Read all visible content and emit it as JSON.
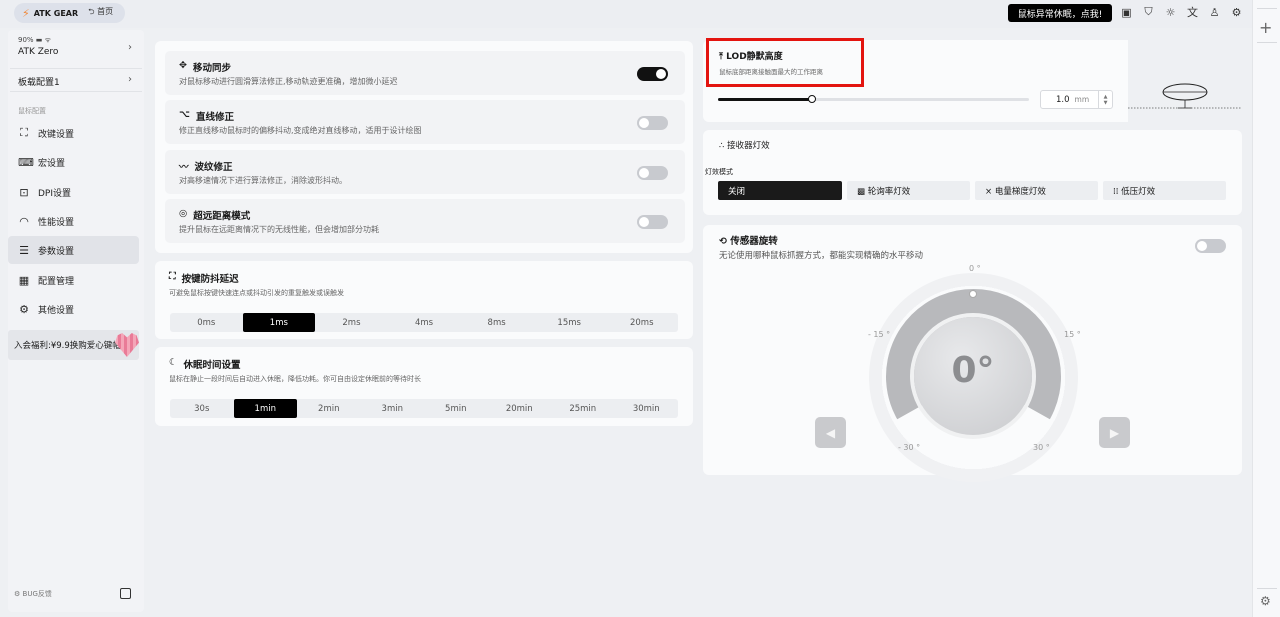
{
  "topbar": {
    "brand": "ATK GEAR",
    "home": "首页",
    "alert_button": "鼠标异常休眠，点我!"
  },
  "sidebar": {
    "device_battery": "90%",
    "device_name": "ATK Zero",
    "profile": "板载配置1",
    "section_title": "鼠标配置",
    "items": [
      {
        "label": "改键设置",
        "icon": "mouse-icon"
      },
      {
        "label": "宏设置",
        "icon": "terminal-icon"
      },
      {
        "label": "DPI设置",
        "icon": "dpi-icon"
      },
      {
        "label": "性能设置",
        "icon": "gauge-icon"
      },
      {
        "label": "参数设置",
        "icon": "sliders-icon"
      },
      {
        "label": "配置管理",
        "icon": "grid-icon"
      },
      {
        "label": "其他设置",
        "icon": "settings-icon"
      }
    ],
    "active_index": 4,
    "promo": "入会福利:¥9.9换购爱心键帽",
    "bug_label": "BUG反馈"
  },
  "settings": [
    {
      "title": "移动同步",
      "desc": "对鼠标移动进行圆滑算法修正,移动轨迹更准确，增加微小延迟",
      "on": true
    },
    {
      "title": "直线修正",
      "desc": "修正直线移动鼠标时的偏移抖动,变成绝对直线移动，适用于设计绘图",
      "on": false
    },
    {
      "title": "波纹修正",
      "desc": "对高移速情况下进行算法修正，消除波形抖动。",
      "on": false
    },
    {
      "title": "超远距离模式",
      "desc": "提升鼠标在远距离情况下的无线性能，但会增加部分功耗",
      "on": false
    }
  ],
  "debounce": {
    "title": "按键防抖延迟",
    "desc": "可避免鼠标按键快速连点或抖动引发的重复触发或误触发",
    "options": [
      "0ms",
      "1ms",
      "2ms",
      "4ms",
      "8ms",
      "15ms",
      "20ms"
    ],
    "selected": 1
  },
  "sleep": {
    "title": "休眠时间设置",
    "desc": "鼠标在静止一段时间后自动进入休眠，降低功耗。你可自由设定休眠前的等待时长",
    "options": [
      "30s",
      "1min",
      "2min",
      "3min",
      "5min",
      "20min",
      "25min",
      "30min"
    ],
    "selected": 1
  },
  "lod": {
    "title": "LOD静默高度",
    "desc": "鼠标底部距离接触面最大的工作距离",
    "value": "1.0",
    "unit": "mm",
    "level_fraction": 0.3
  },
  "receiver": {
    "title": "接收器灯效",
    "mode_label": "灯效模式",
    "options": [
      "关闭",
      "轮询率灯效",
      "电量梯度灯效",
      "低压灯效"
    ],
    "selected": 0
  },
  "sensor": {
    "title": "传感器旋转",
    "desc": "无论使用哪种鼠标抓握方式，都能实现精确的水平移动",
    "on": false,
    "value": "0°",
    "ticks": {
      "top": "0 °",
      "left15": "- 15 °",
      "right15": "15 °",
      "left30": "- 30 °",
      "right30": "30 °"
    }
  }
}
